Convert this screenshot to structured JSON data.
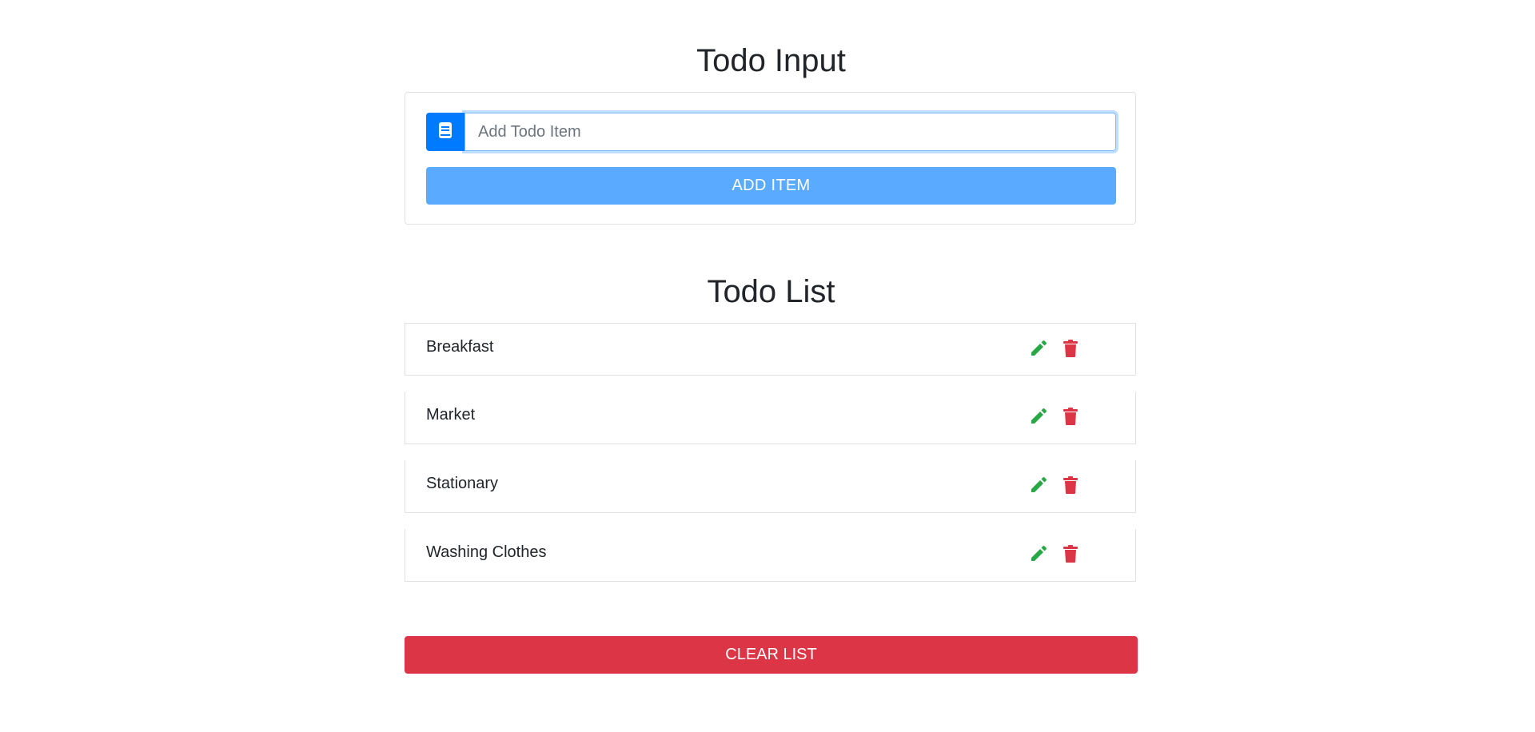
{
  "input_section": {
    "title": "Todo Input",
    "placeholder": "Add Todo Item",
    "value": "",
    "add_label": "ADD ITEM",
    "prepend_icon": "book-icon"
  },
  "list_section": {
    "title": "Todo List",
    "items": [
      {
        "label": "Breakfast",
        "edit_icon": "pencil-icon",
        "delete_icon": "trash-icon"
      },
      {
        "label": "Market",
        "edit_icon": "pencil-icon",
        "delete_icon": "trash-icon"
      },
      {
        "label": "Stationary",
        "edit_icon": "pencil-icon",
        "delete_icon": "trash-icon"
      },
      {
        "label": "Washing Clothes",
        "edit_icon": "pencil-icon",
        "delete_icon": "trash-icon"
      }
    ],
    "clear_label": "CLEAR LIST"
  },
  "colors": {
    "primary": "#007bff",
    "add_button": "#5aabff",
    "edit": "#28a745",
    "delete": "#dc3545",
    "clear": "#dc3545"
  }
}
